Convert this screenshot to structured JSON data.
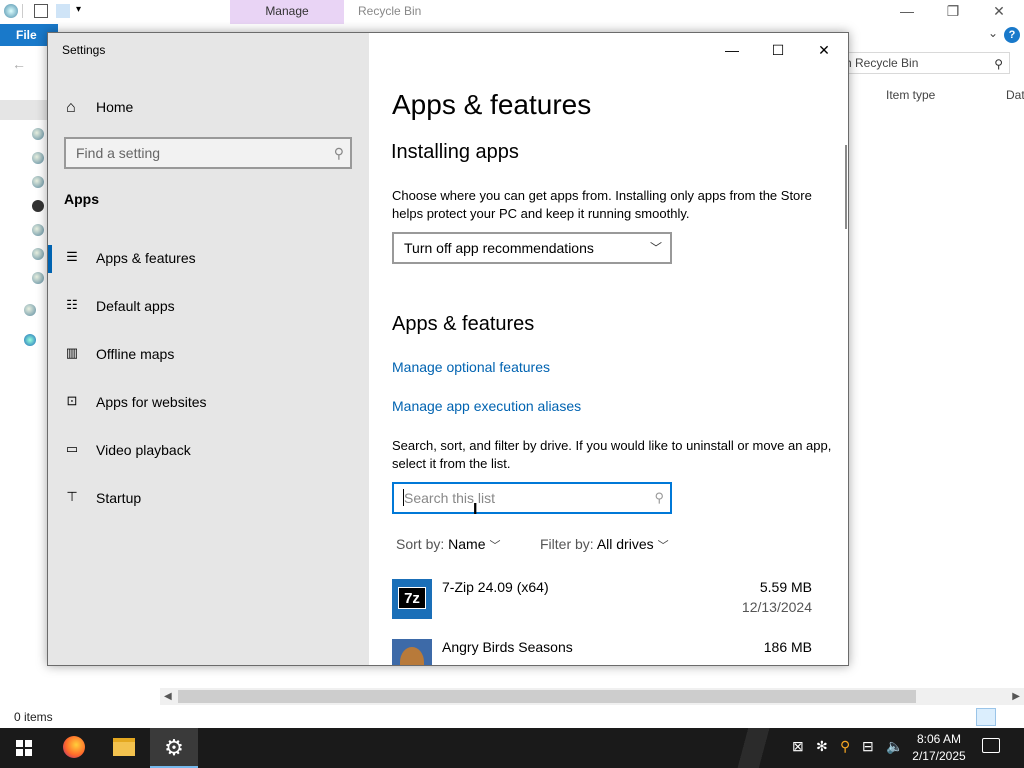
{
  "explorer": {
    "contextual_tab": "Manage",
    "title": "Recycle Bin",
    "file_tab": "File",
    "help": "?",
    "search_placeholder": "h Recycle Bin",
    "columns": [
      "Item type",
      "Dat"
    ],
    "status": "0 items"
  },
  "settings": {
    "window_title": "Settings",
    "nav_home": "Home",
    "find_placeholder": "Find a setting",
    "section": "Apps",
    "nav_items": [
      {
        "label": "Apps & features",
        "icon": "list-icon",
        "selected": true
      },
      {
        "label": "Default apps",
        "icon": "default-apps-icon",
        "selected": false
      },
      {
        "label": "Offline maps",
        "icon": "map-icon",
        "selected": false
      },
      {
        "label": "Apps for websites",
        "icon": "open-link-icon",
        "selected": false
      },
      {
        "label": "Video playback",
        "icon": "video-icon",
        "selected": false
      },
      {
        "label": "Startup",
        "icon": "startup-icon",
        "selected": false
      }
    ],
    "page_title": "Apps & features",
    "installing_heading": "Installing apps",
    "installing_desc": "Choose where you can get apps from. Installing only apps from the Store helps protect your PC and keep it running smoothly.",
    "app_source_value": "Turn off app recommendations",
    "af_heading": "Apps & features",
    "link_optional": "Manage optional features",
    "link_aliases": "Manage app execution aliases",
    "search_desc": "Search, sort, and filter by drive. If you would like to uninstall or move an app, select it from the list.",
    "search_placeholder": "Search this list",
    "sort_label": "Sort by:",
    "sort_value": "Name",
    "filter_label": "Filter by:",
    "filter_value": "All drives",
    "apps": [
      {
        "name": "7-Zip 24.09 (x64)",
        "size": "5.59 MB",
        "date": "12/13/2024"
      },
      {
        "name": "Angry Birds Seasons",
        "size": "186 MB",
        "date": ""
      }
    ]
  },
  "taskbar": {
    "time": "8:06 AM",
    "date": "2/17/2025"
  }
}
